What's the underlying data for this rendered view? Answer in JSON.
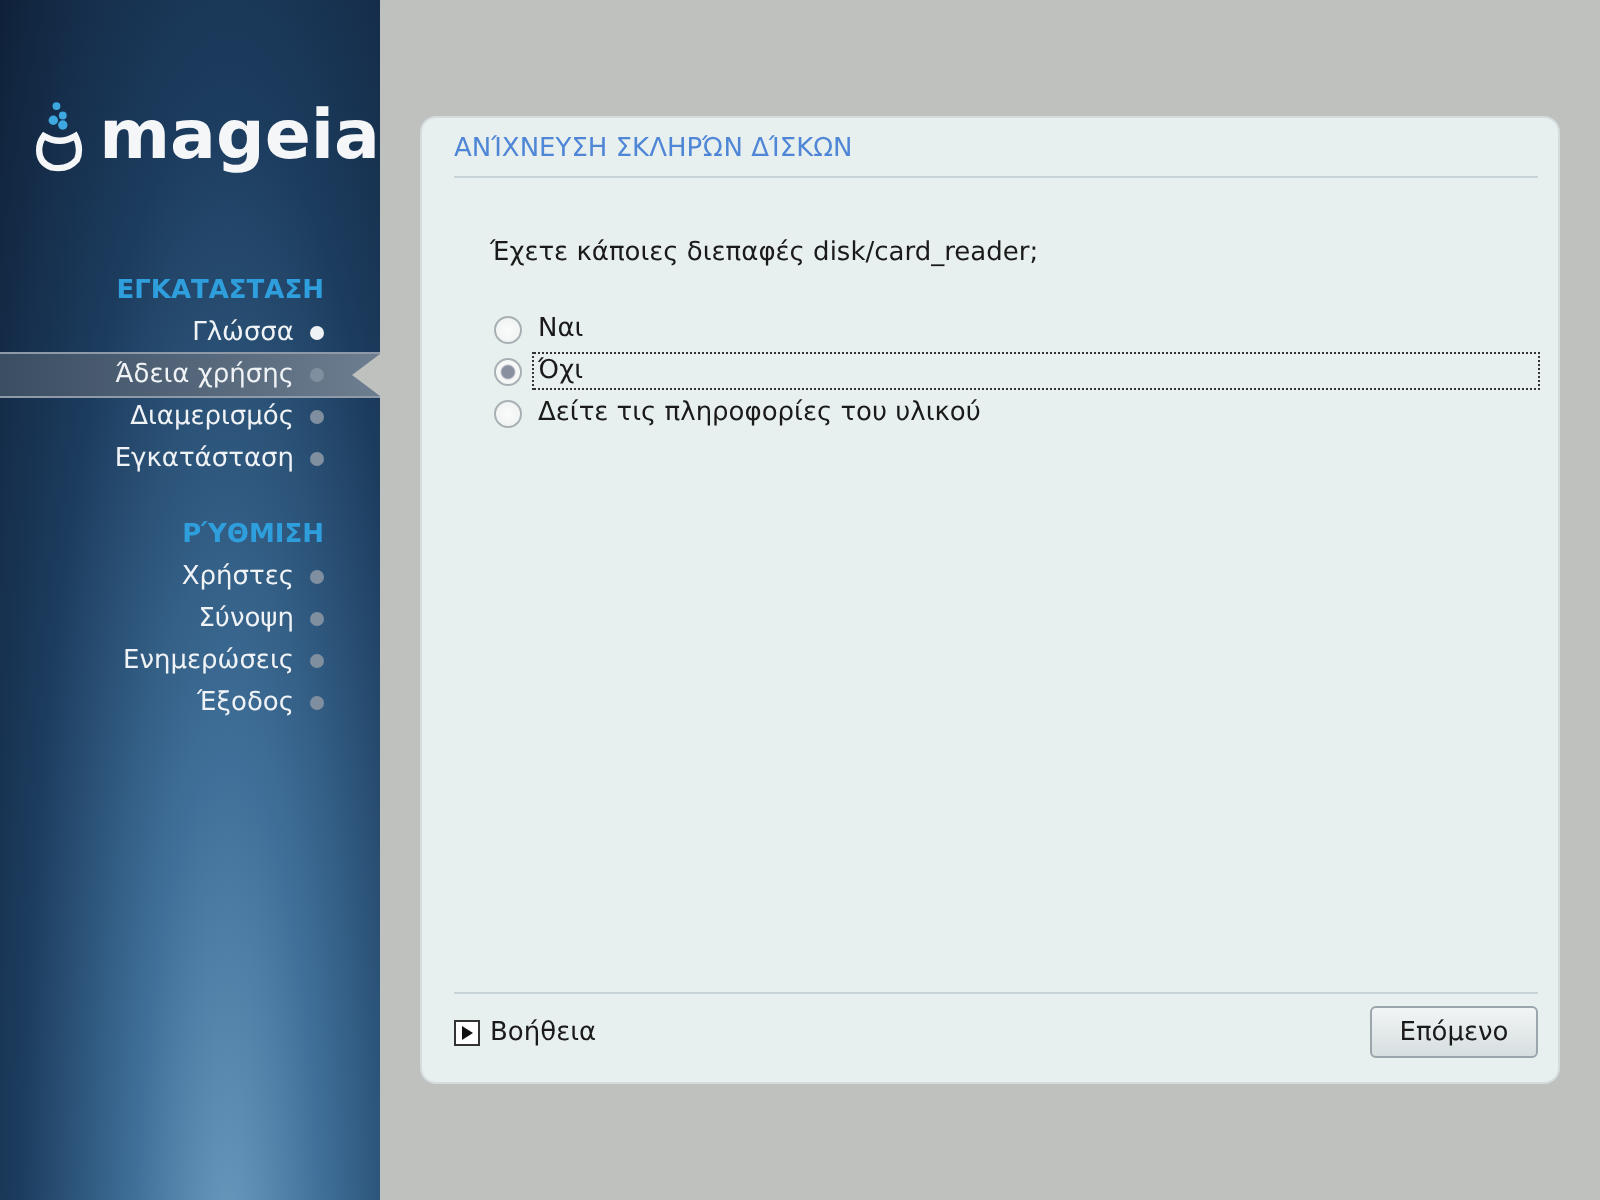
{
  "logo": {
    "text": "mageia"
  },
  "sidebar": {
    "sections": [
      {
        "title": "ΕΓΚΑΤΑΣΤΑΣΗ",
        "items": [
          {
            "label": "Γλώσσα",
            "selected": false,
            "done": true
          },
          {
            "label": "Άδεια χρήσης",
            "selected": true,
            "done": false
          },
          {
            "label": "Διαμερισμός",
            "selected": false,
            "done": false
          },
          {
            "label": "Εγκατάσταση",
            "selected": false,
            "done": false
          }
        ]
      },
      {
        "title": "ΡΎΘΜΙΣΗ",
        "items": [
          {
            "label": "Χρήστες",
            "selected": false,
            "done": false
          },
          {
            "label": "Σύνοψη",
            "selected": false,
            "done": false
          },
          {
            "label": "Ενημερώσεις",
            "selected": false,
            "done": false
          },
          {
            "label": "Έξοδος",
            "selected": false,
            "done": false
          }
        ]
      }
    ]
  },
  "panel": {
    "title": "ΑΝΊΧΝΕΥΣΗ ΣΚΛΗΡΏΝ ΔΊΣΚΩΝ",
    "question": "Έχετε κάποιες διεπαφές disk/card_reader;",
    "options": [
      {
        "label": "Ναι",
        "selected": false,
        "focused": false
      },
      {
        "label": "Όχι",
        "selected": true,
        "focused": true
      },
      {
        "label": "Δείτε τις πληροφορίες του υλικού",
        "selected": false,
        "focused": false
      }
    ]
  },
  "footer": {
    "help": "Βοήθεια",
    "next": "Επόμενο"
  }
}
